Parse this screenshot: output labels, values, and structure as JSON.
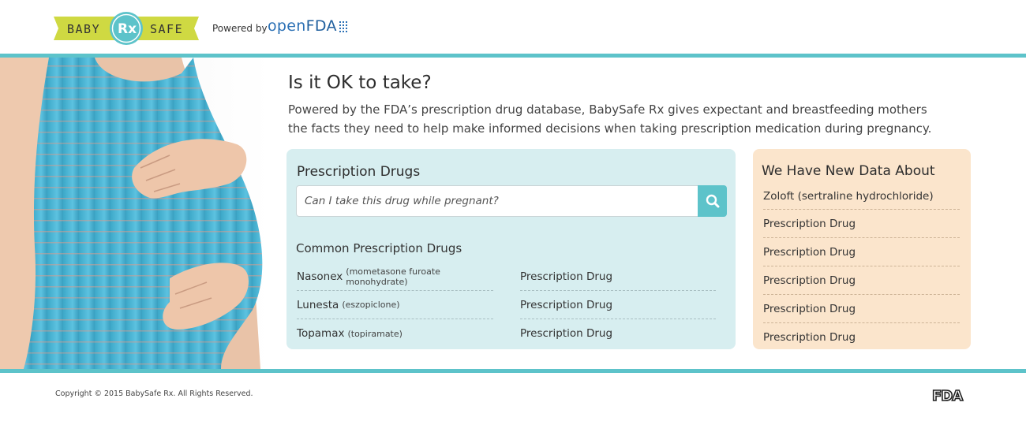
{
  "brand": {
    "logo_left": "BABY",
    "logo_mid": "Rx",
    "logo_right": "SAFE",
    "powered_by": "Powered by",
    "partner_open": "open",
    "partner_fda": "FDA",
    "accent": "#5dc3ca",
    "logo_banner_color": "#cfd942"
  },
  "hero": {
    "headline": "Is it OK to take?",
    "intro": "Powered by the FDA’s prescription drug database, BabySafe Rx gives expectant and breastfeeding mothers the facts they need to help make informed decisions when taking prescription medication during pregnancy."
  },
  "prescription": {
    "title": "Prescription Drugs",
    "search_placeholder": "Can I take this drug while pregnant?",
    "search_icon": "search-icon",
    "common_title": "Common Prescription Drugs",
    "left_items": [
      {
        "name": "Nasonex",
        "generic": "(mometasone furoate monohydrate)"
      },
      {
        "name": "Lunesta",
        "generic": "(eszopiclone)"
      },
      {
        "name": "Topamax",
        "generic": "(topiramate)"
      }
    ],
    "right_items": [
      "Prescription Drug",
      "Prescription Drug",
      "Prescription Drug"
    ],
    "panel_color": "#d7eef0"
  },
  "new_data": {
    "title": "We Have New Data About",
    "items": [
      "Zoloft (sertraline hydrochloride)",
      "Prescription Drug",
      "Prescription Drug",
      "Prescription Drug",
      "Prescription Drug",
      "Prescription Drug"
    ],
    "panel_color": "#fbe5cc"
  },
  "footer": {
    "copyright": "Copyright © 2015 BabySafe Rx. All Rights Reserved.",
    "logo_text": "FDA"
  }
}
